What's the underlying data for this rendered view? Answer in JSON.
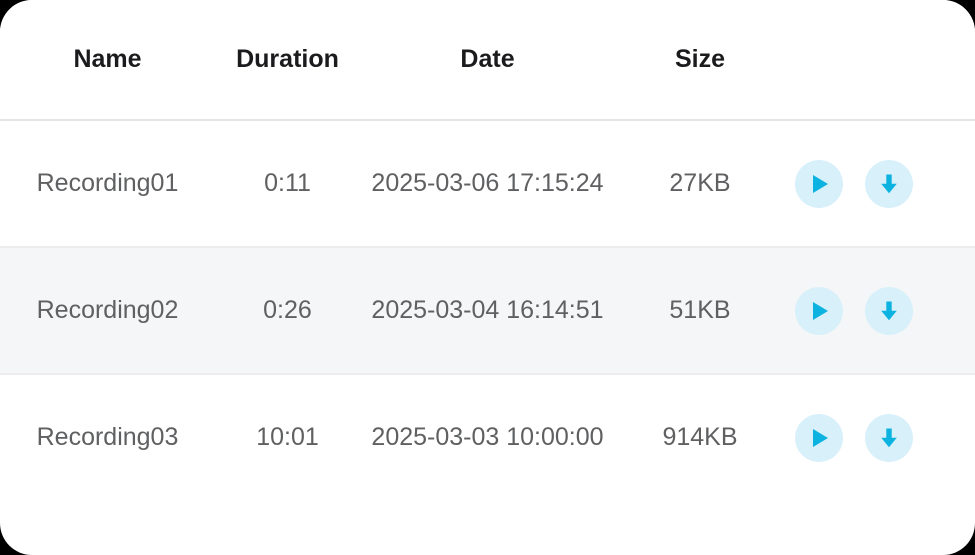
{
  "table": {
    "columns": [
      {
        "key": "name",
        "label": "Name"
      },
      {
        "key": "duration",
        "label": "Duration"
      },
      {
        "key": "date",
        "label": "Date"
      },
      {
        "key": "size",
        "label": "Size"
      },
      {
        "key": "actions",
        "label": ""
      }
    ],
    "rows": [
      {
        "name": "Recording01",
        "duration": "0:11",
        "date": "2025-03-06 17:15:24",
        "size": "27KB",
        "actions": [
          {
            "icon": "play-icon",
            "label": "Play"
          },
          {
            "icon": "download-icon",
            "label": "Download"
          }
        ]
      },
      {
        "name": "Recording02",
        "duration": "0:26",
        "date": "2025-03-04 16:14:51",
        "size": "51KB",
        "actions": [
          {
            "icon": "play-icon",
            "label": "Play"
          },
          {
            "icon": "download-icon",
            "label": "Download"
          }
        ]
      },
      {
        "name": "Recording03",
        "duration": "10:01",
        "date": "2025-03-03 10:00:00",
        "size": "914KB",
        "actions": [
          {
            "icon": "play-icon",
            "label": "Play"
          },
          {
            "icon": "download-icon",
            "label": "Download"
          }
        ]
      }
    ]
  },
  "colors": {
    "card_background": "#ffffff",
    "page_background": "#000000",
    "header_text": "#1b1b1e",
    "row_text": "#5f6062",
    "row_stripe": "#f5f6f7",
    "divider": "#ececee",
    "header_divider": "#e4e5e7",
    "icon_accent": "#0cb3e0",
    "icon_button_background": "#d8f0fa"
  }
}
